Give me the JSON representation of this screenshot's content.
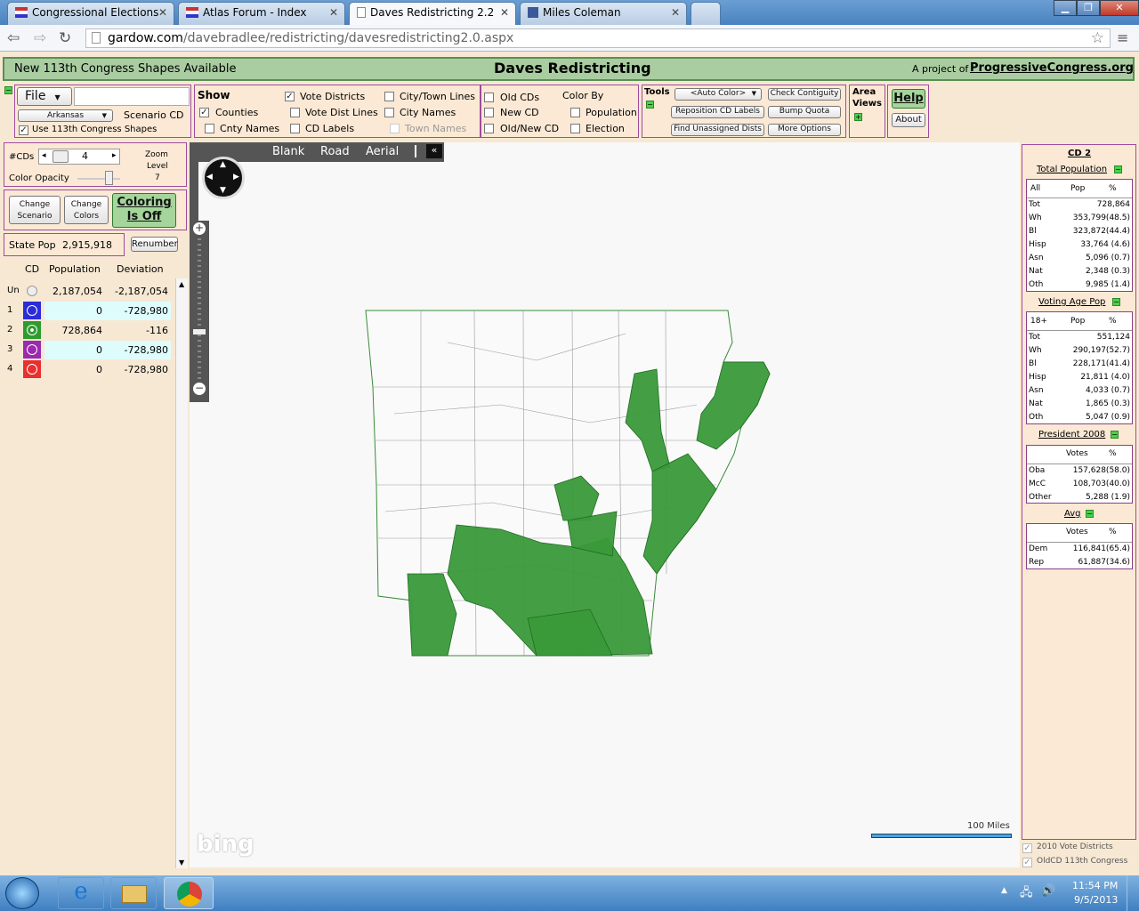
{
  "browser": {
    "tabs": [
      {
        "label": "Congressional Elections"
      },
      {
        "label": "Atlas Forum - Index"
      },
      {
        "label": "Daves Redistricting 2.2"
      },
      {
        "label": "Miles Coleman"
      }
    ],
    "url_host": "gardow.com",
    "url_path": "/davebradlee/redistricting/davesredistricting2.0.aspx"
  },
  "header": {
    "notice": "New 113th Congress Shapes Available",
    "title": "Daves Redistricting",
    "project_prefix": "A project of",
    "project_link": "ProgressiveCongress.org"
  },
  "file_panel": {
    "file_label": "File",
    "state": "Arkansas",
    "scenario": "Scenario CD",
    "use_shapes": "Use 113th Congress Shapes"
  },
  "show_panel": {
    "title": "Show",
    "items": {
      "vote_districts": "Vote Districts",
      "city_town_lines": "City/Town Lines",
      "counties": "Counties",
      "vote_dist_lines": "Vote Dist Lines",
      "city_names": "City Names",
      "cnty_names": "Cnty Names",
      "cd_labels": "CD Labels",
      "town_names": "Town Names"
    }
  },
  "color_panel": {
    "old_cds": "Old CDs",
    "new_cd": "New CD",
    "old_new_cd": "Old/New CD",
    "color_by": "Color By",
    "population": "Population",
    "election": "Election"
  },
  "tools_panel": {
    "title": "Tools",
    "auto_color": "<Auto Color>",
    "check_contiguity": "Check Contiguity",
    "reposition": "Reposition CD Labels",
    "bump_quota": "Bump Quota",
    "find_unassigned": "Find Unassigned Dists",
    "more_options": "More Options"
  },
  "area_views": {
    "line1": "Area",
    "line2": "Views"
  },
  "help": {
    "help": "Help",
    "about": "About"
  },
  "left_controls": {
    "cds_label": "#CDs",
    "cds_value": "4",
    "zoom_label1": "Zoom",
    "zoom_label2": "Level",
    "zoom_value": "7",
    "color_opacity": "Color Opacity",
    "change_scenario1": "Change",
    "change_scenario2": "Scenario",
    "change_colors1": "Change",
    "change_colors2": "Colors",
    "coloring1": "Coloring",
    "coloring2": "Is Off",
    "state_pop_label": "State Pop",
    "state_pop": "2,915,918",
    "renumber": "Renumber"
  },
  "cd_table": {
    "headers": {
      "cd": "CD",
      "pop": "Population",
      "dev": "Deviation"
    },
    "rows": [
      {
        "cd": "Un",
        "pop": "2,187,054",
        "dev": "-2,187,054",
        "color": "#f0f0f0"
      },
      {
        "cd": "1",
        "pop": "0",
        "dev": "-728,980",
        "color": "#2b2bd8"
      },
      {
        "cd": "2",
        "pop": "728,864",
        "dev": "-116",
        "color": "#2e9b2e"
      },
      {
        "cd": "3",
        "pop": "0",
        "dev": "-728,980",
        "color": "#9a2ab0"
      },
      {
        "cd": "4",
        "pop": "0",
        "dev": "-728,980",
        "color": "#e8302f"
      }
    ]
  },
  "map": {
    "tabs": {
      "blank": "Blank",
      "road": "Road",
      "aerial": "Aerial"
    },
    "scale": "100 Miles",
    "logo": "bing"
  },
  "stats": {
    "title": "CD 2",
    "total_pop_title": "Total Population",
    "total_pop_headers": [
      "All",
      "Pop",
      "%"
    ],
    "total_pop": [
      {
        "k": "Tot",
        "v": "728,864"
      },
      {
        "k": "Wh",
        "v": "353,799(48.5)"
      },
      {
        "k": "Bl",
        "v": "323,872(44.4)"
      },
      {
        "k": "Hisp",
        "v": "33,764 (4.6)"
      },
      {
        "k": "Asn",
        "v": "5,096 (0.7)"
      },
      {
        "k": "Nat",
        "v": "2,348 (0.3)"
      },
      {
        "k": "Oth",
        "v": "9,985 (1.4)"
      }
    ],
    "vap_title": "Voting Age Pop",
    "vap_headers": [
      "18+",
      "Pop",
      "%"
    ],
    "vap": [
      {
        "k": "Tot",
        "v": "551,124"
      },
      {
        "k": "Wh",
        "v": "290,197(52.7)"
      },
      {
        "k": "Bl",
        "v": "228,171(41.4)"
      },
      {
        "k": "Hisp",
        "v": "21,811 (4.0)"
      },
      {
        "k": "Asn",
        "v": "4,033 (0.7)"
      },
      {
        "k": "Nat",
        "v": "1,865 (0.3)"
      },
      {
        "k": "Oth",
        "v": "5,047 (0.9)"
      }
    ],
    "pres_title": "President 2008",
    "pres_headers": [
      "Votes",
      "%"
    ],
    "pres": [
      {
        "k": "Oba",
        "v": "157,628(58.0)"
      },
      {
        "k": "McC",
        "v": "108,703(40.0)"
      },
      {
        "k": "Other",
        "v": "5,288 (1.9)"
      }
    ],
    "avg_title": "Avg",
    "avg_headers": [
      "Votes",
      "%"
    ],
    "avg": [
      {
        "k": "Dem",
        "v": "116,841(65.4)"
      },
      {
        "k": "Rep",
        "v": "61,887(34.6)"
      }
    ],
    "layer1": "2010 Vote Districts",
    "layer2": "OldCD 113th Congress"
  },
  "taskbar": {
    "time": "11:54 PM",
    "date": "9/5/2013"
  }
}
